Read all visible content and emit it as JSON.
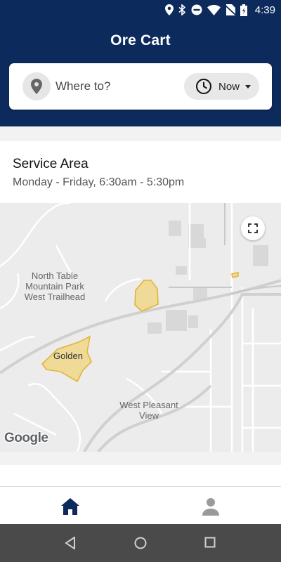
{
  "status_bar": {
    "time": "4:39",
    "icons": [
      "location-icon",
      "bluetooth-icon",
      "do-not-disturb-icon",
      "wifi-icon",
      "no-sim-icon",
      "battery-icon"
    ]
  },
  "header": {
    "title": "Ore Cart",
    "background_color": "#0d2a5c"
  },
  "search": {
    "placeholder": "Where to?",
    "time_option": "Now"
  },
  "service_area": {
    "title": "Service Area",
    "hours": "Monday - Friday, 6:30am - 5:30pm"
  },
  "map": {
    "labels": {
      "north_table": "North Table Mountain Park West Trailhead",
      "golden": "Golden",
      "west_pleasant": "West Pleasant View"
    },
    "attribution": "Google",
    "zone_color": "#f1d26a"
  },
  "bottom_nav": {
    "items": [
      "home-icon",
      "profile-icon"
    ],
    "active": "home-icon"
  }
}
